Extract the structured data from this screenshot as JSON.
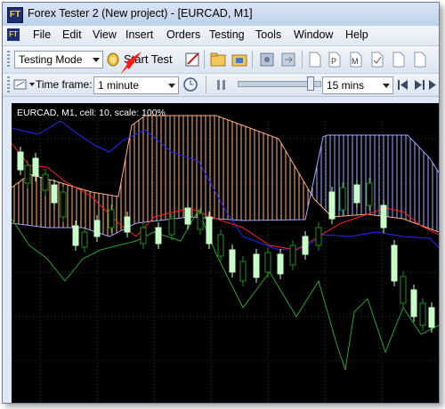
{
  "window": {
    "title": "Forex Tester 2  (New  project) - [EURCAD, M1]",
    "app_icon_label": "FT"
  },
  "menu": {
    "items": [
      {
        "label": "File"
      },
      {
        "label": "Edit"
      },
      {
        "label": "View"
      },
      {
        "label": "Insert"
      },
      {
        "label": "Orders"
      },
      {
        "label": "Testing"
      },
      {
        "label": "Tools"
      },
      {
        "label": "Window"
      },
      {
        "label": "Help"
      }
    ]
  },
  "toolbar": {
    "mode_select": "Testing Mode",
    "start_test_label": "Start Test",
    "timeframe_label": "Time frame:",
    "timeframe_select": "1 minute",
    "speed_select": "15 mins",
    "annotation_arrow_color": "#ff1a1a"
  },
  "chart": {
    "label": "EURCAD, M1, cell: 10, scale: 100%",
    "background": "#000000",
    "colors": {
      "cloud_up": "#ffb080",
      "cloud_down": "#a0a8ff",
      "kijun": "#1e2cff",
      "tenkan": "#ff2020",
      "chikou": "#2fa02f",
      "bull_candle": "#c8ffc8",
      "bear_candle": "#1b8f1b",
      "grid": "#2a3a2a"
    }
  }
}
